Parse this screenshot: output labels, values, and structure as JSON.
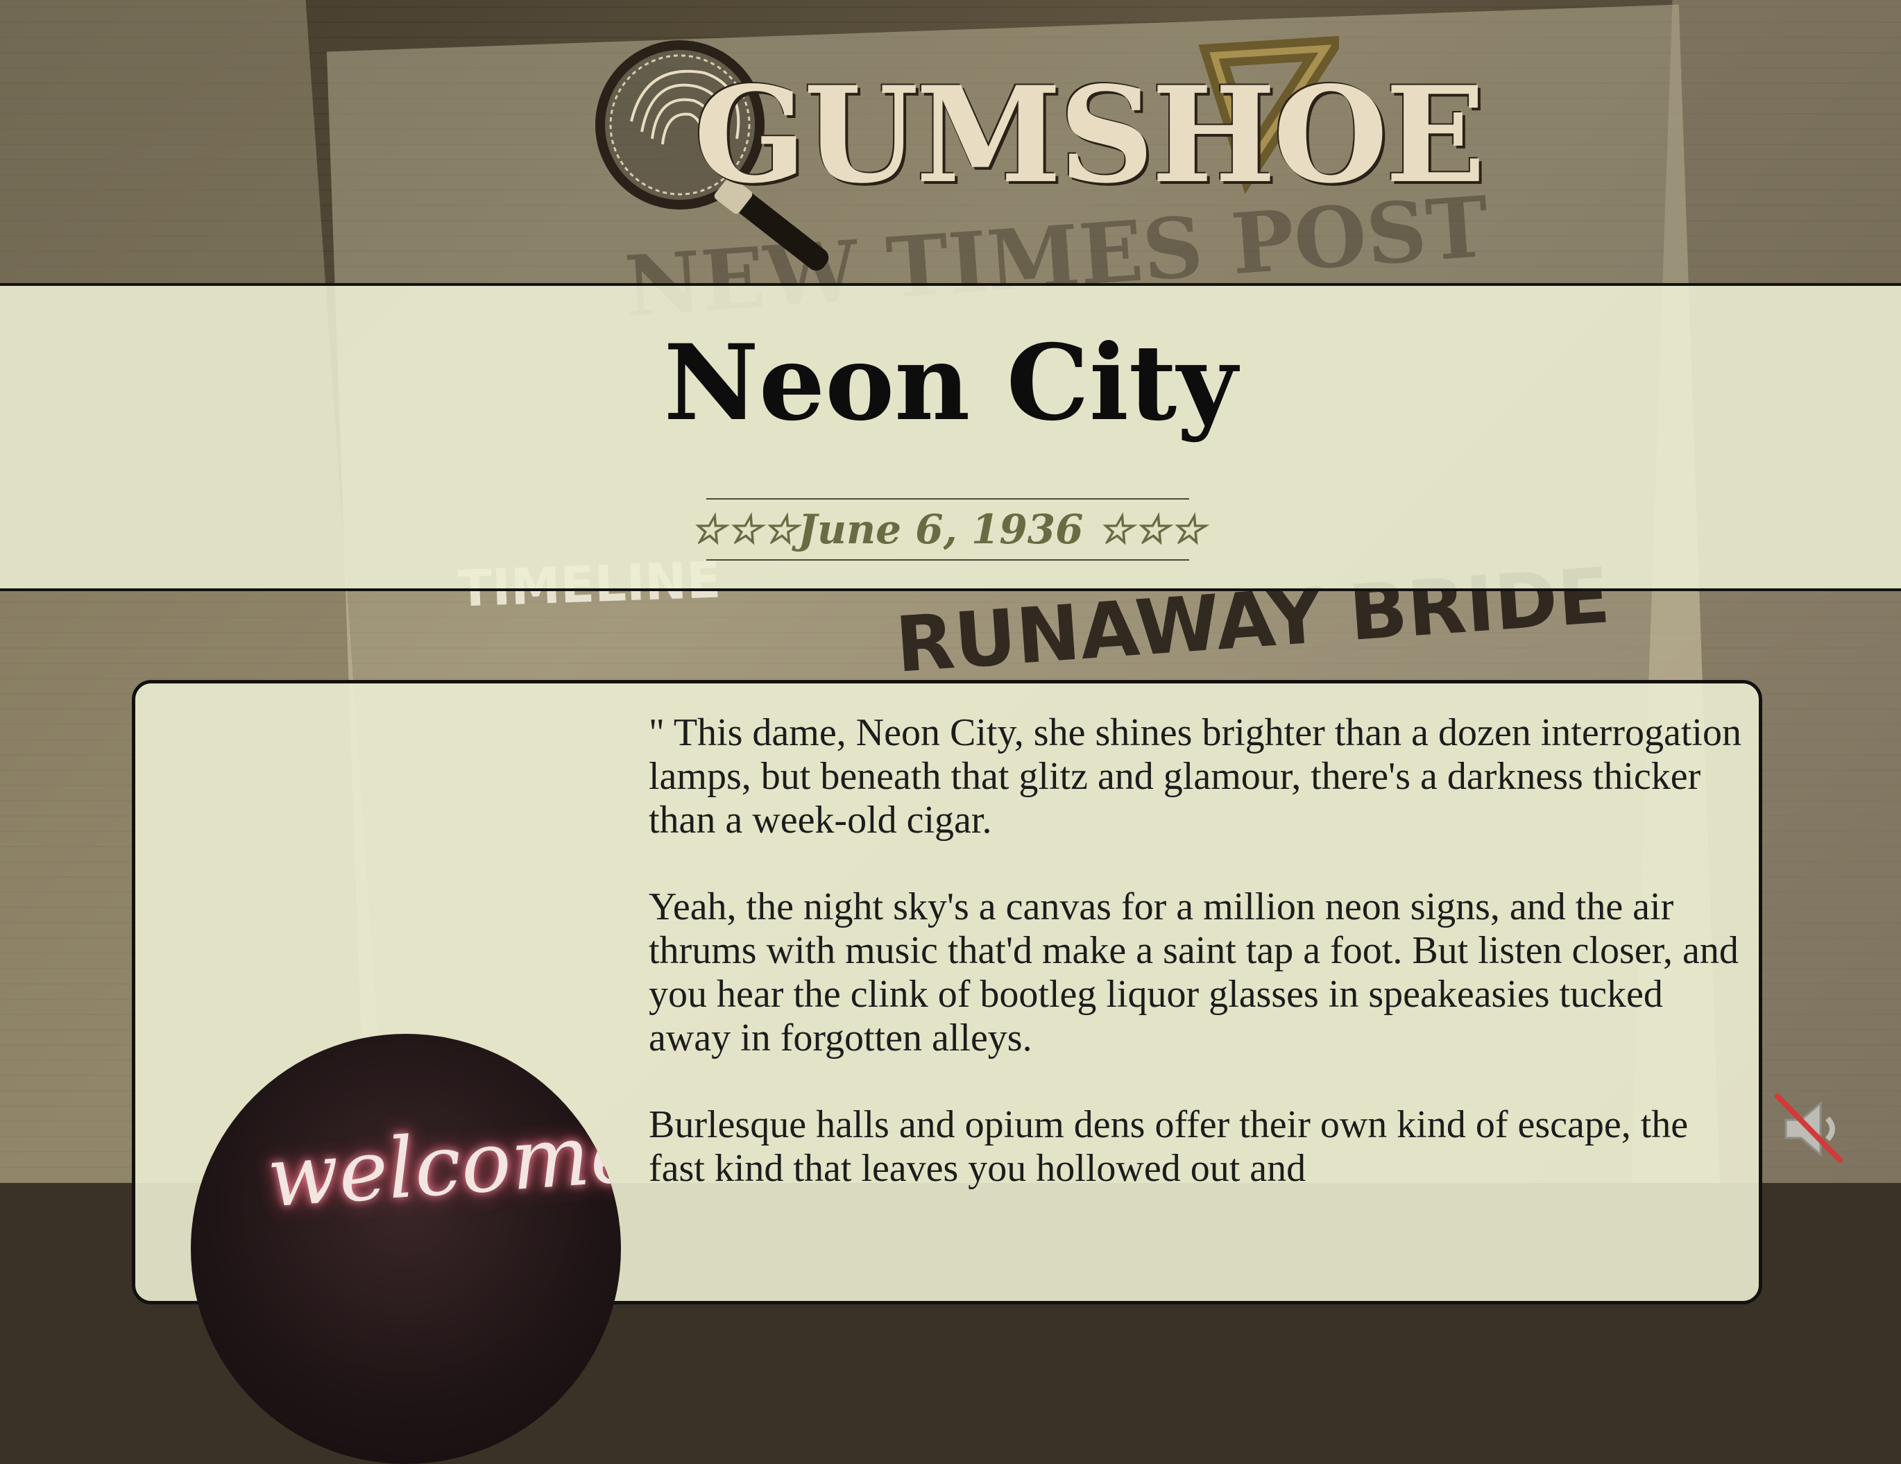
{
  "header": {
    "logo_text": "GUMSHOE"
  },
  "background": {
    "newspaper_name": "NEW TIMES POST",
    "headline": "RUNAWAY BRIDE",
    "section": "TIMELINE"
  },
  "title_band": {
    "title": "Neon City",
    "date_line": "☆☆☆June 6, 1936 ☆☆☆"
  },
  "story": {
    "paragraphs": [
      "\" This dame, Neon City, she shines brighter than a dozen interrogation lamps, but beneath that glitz and glamour, there's a darkness thicker than a week-old cigar.",
      "Yeah, the night sky's a canvas for a million neon signs, and the air thrums with music that'd make a saint tap a foot. But listen closer, and you hear the clink of bootleg liquor glasses in speakeasies tucked away in forgotten alleys.",
      "Burlesque halls and opium dens offer their own kind of escape, the fast kind that leaves you hollowed out and"
    ],
    "image_sign_text": "welcome"
  },
  "controls": {
    "mute_icon": "speaker-muted-icon",
    "mute_slash_color": "#d23a3a"
  },
  "colors": {
    "band_bg": "#ecedd2",
    "date_color": "#6a6b43",
    "title_color": "#0d0d0d"
  }
}
